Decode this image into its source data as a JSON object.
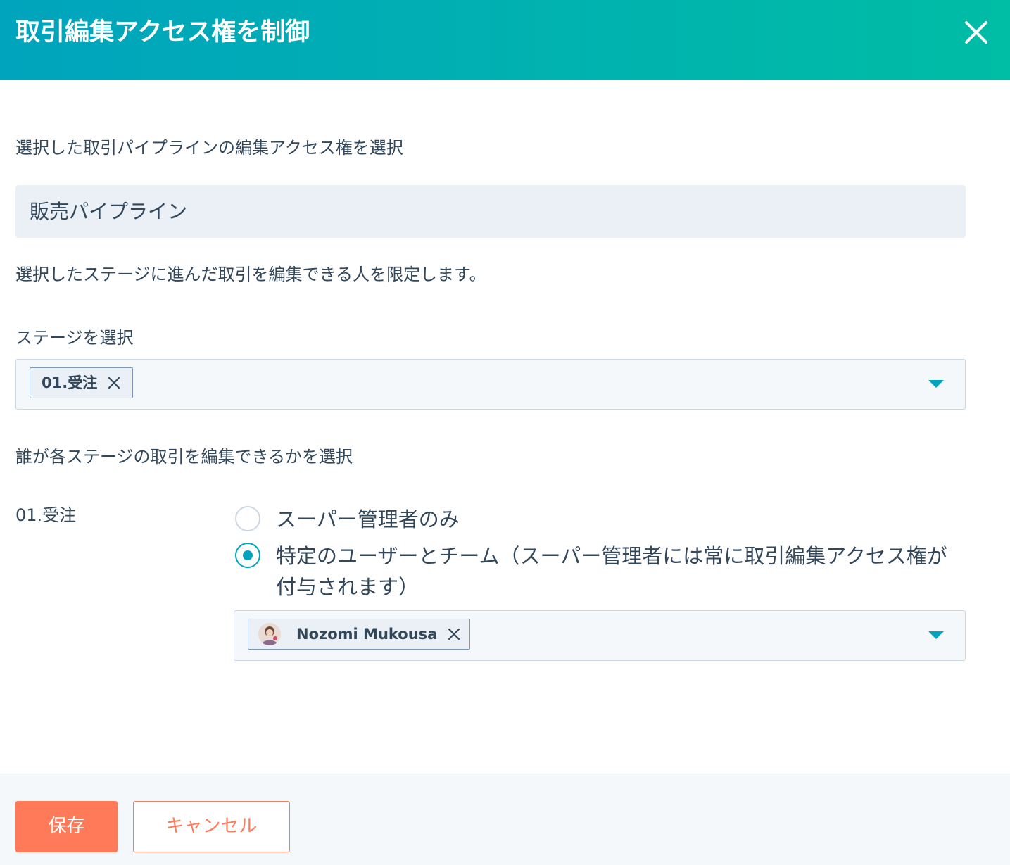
{
  "header": {
    "title": "取引編集アクセス権を制御",
    "close_icon": "close-icon"
  },
  "intro": "選択した取引パイプラインの編集アクセス権を選択",
  "pipeline": {
    "value": "販売パイプライン"
  },
  "limit_text": "選択したステージに進んだ取引を編集できる人を限定します。",
  "stage_select": {
    "label": "ステージを選択",
    "selected": [
      {
        "label": "01.受注"
      }
    ],
    "caret_icon": "caret-down-icon"
  },
  "who_label": "誰が各ステージの取引を編集できるかを選択",
  "stage_row": {
    "stage_name": "01.受注",
    "options": [
      {
        "label": "スーパー管理者のみ",
        "selected": false
      },
      {
        "label": "特定のユーザーとチーム（スーパー管理者には常に取引編集アクセス権が付与されます）",
        "selected": true
      }
    ],
    "users_select": {
      "selected": [
        {
          "name": "Nozomi Mukousa",
          "avatar_icon": "avatar"
        }
      ],
      "caret_icon": "caret-down-icon"
    }
  },
  "footer": {
    "save_label": "保存",
    "cancel_label": "キャンセル"
  },
  "colors": {
    "header_start": "#00a4bd",
    "header_end": "#00bda5",
    "accent": "#00a4bd",
    "primary_button": "#ff7a59",
    "text": "#33475b"
  }
}
